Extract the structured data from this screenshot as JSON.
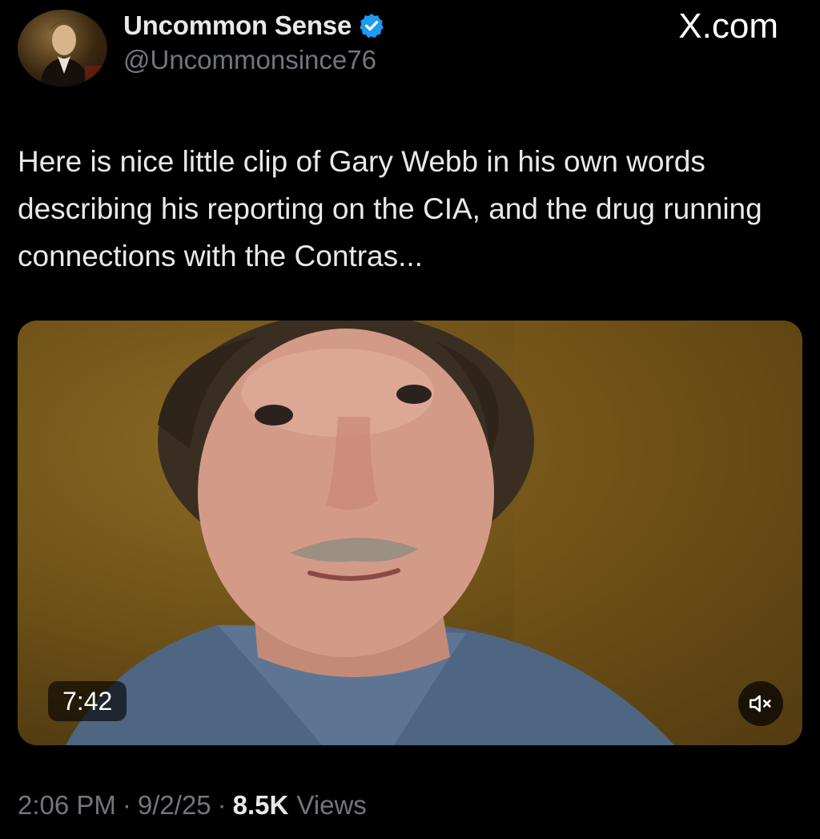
{
  "author": {
    "display_name": "Uncommon Sense",
    "handle": "@Uncommonsince76",
    "verified": true,
    "avatar_icon": "portrait-avatar-icon"
  },
  "watermark": "X.com",
  "tweet": {
    "text": "Here is nice little clip of Gary Webb in his own words describing his reporting on the CIA, and the drug running connections with the Contras..."
  },
  "media": {
    "type": "video",
    "duration": "7:42",
    "muted": true,
    "mute_icon": "speaker-muted-icon"
  },
  "meta": {
    "time": "2:06 PM",
    "separator": "·",
    "date": "9/2/25",
    "views_count": "8.5K",
    "views_label": "Views"
  },
  "colors": {
    "background": "#000000",
    "primary_text": "#e7e9ea",
    "secondary_text": "#71767b",
    "verified_badge": "#1d9bf0"
  }
}
